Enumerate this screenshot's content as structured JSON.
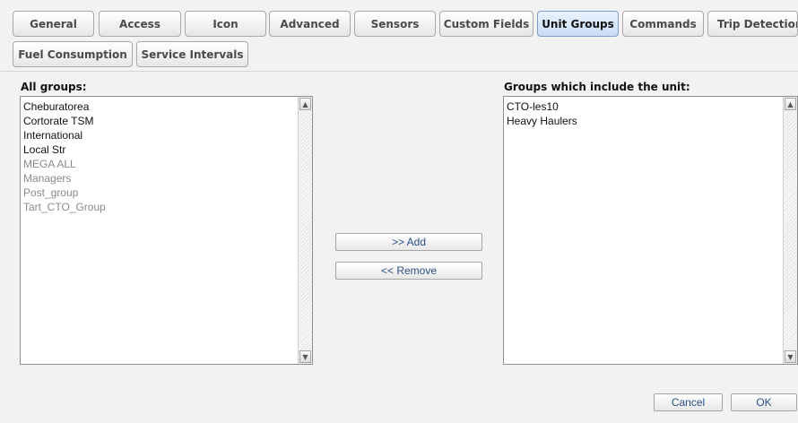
{
  "tabs": {
    "row1": [
      "General",
      "Access",
      "Icon",
      "Advanced",
      "Sensors",
      "Custom Fields",
      "Unit Groups",
      "Commands",
      "Trip Detection"
    ],
    "row2": [
      "Fuel Consumption",
      "Service Intervals"
    ],
    "active": "Unit Groups"
  },
  "all_groups": {
    "label": "All groups:",
    "items": [
      "Cheburatorea",
      "Cortorate TSM",
      "International",
      "Local Str",
      "MEGA ALL",
      "Managers",
      "Post_group",
      "Tart_CTO_Group"
    ]
  },
  "included_groups": {
    "label": "Groups which include the unit:",
    "items": [
      "CTO-les10",
      "Heavy Haulers"
    ]
  },
  "actions": {
    "add_label": ">> Add",
    "remove_label": "<< Remove"
  },
  "footer": {
    "cancel_label": "Cancel",
    "ok_label": "OK"
  },
  "colors": {
    "active_tab": "#c9dcf6",
    "disabled_item_text": "#8a8a8a",
    "button_text": "#2a4f86"
  }
}
